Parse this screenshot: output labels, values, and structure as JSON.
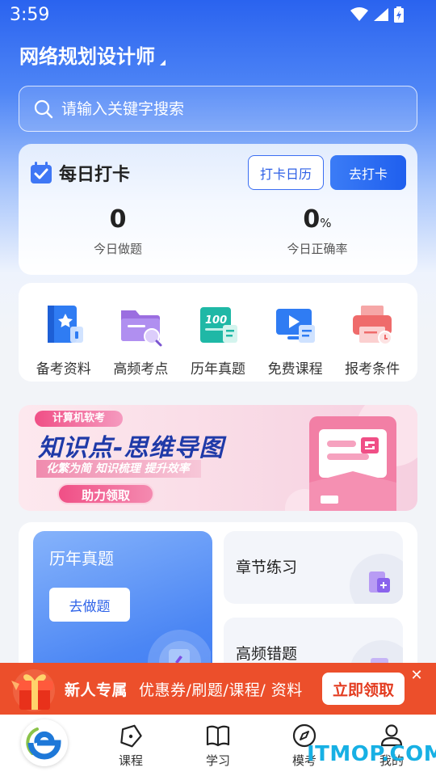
{
  "status_bar": {
    "time": "3:59"
  },
  "header": {
    "title": "网络规划设计师"
  },
  "search": {
    "placeholder": "请输入关键字搜索"
  },
  "checkin": {
    "title": "每日打卡",
    "calendar_button": "打卡日历",
    "go_button": "去打卡",
    "today_questions": {
      "value": "0",
      "label": "今日做题"
    },
    "today_accuracy": {
      "value": "0",
      "unit": "%",
      "label": "今日正确率"
    }
  },
  "quick_menu": [
    {
      "label": "备考资料",
      "icon": "book-icon"
    },
    {
      "label": "高频考点",
      "icon": "folder-search-icon"
    },
    {
      "label": "历年真题",
      "icon": "paper-100-icon"
    },
    {
      "label": "免费课程",
      "icon": "video-play-icon"
    },
    {
      "label": "报考条件",
      "icon": "printer-icon"
    }
  ],
  "banner": {
    "tag": "计算机软考",
    "headline": "知识点-思维导图",
    "subline": "化繁为简 知识梳理 提升效率",
    "cta": "助力领取"
  },
  "practice": {
    "past_papers": {
      "title": "历年真题",
      "button": "去做题"
    },
    "chapter_practice": {
      "title": "章节练习"
    },
    "frequent_errors": {
      "title": "高频错题"
    }
  },
  "promo": {
    "label": "新人专属",
    "text": "优惠券/刷题/课程/ 资料",
    "button": "立即领取"
  },
  "tabs": [
    {
      "label": "课程",
      "icon": "course-icon"
    },
    {
      "label": "学习",
      "icon": "book-open-icon"
    },
    {
      "label": "模考",
      "icon": "compass-icon"
    },
    {
      "label": "我的",
      "icon": "user-icon"
    }
  ],
  "watermark": "ITMOP.COM",
  "colors": {
    "primary": "#2a63ef",
    "promo": "#ec4f2b",
    "banner_text": "#1f3aa8"
  }
}
